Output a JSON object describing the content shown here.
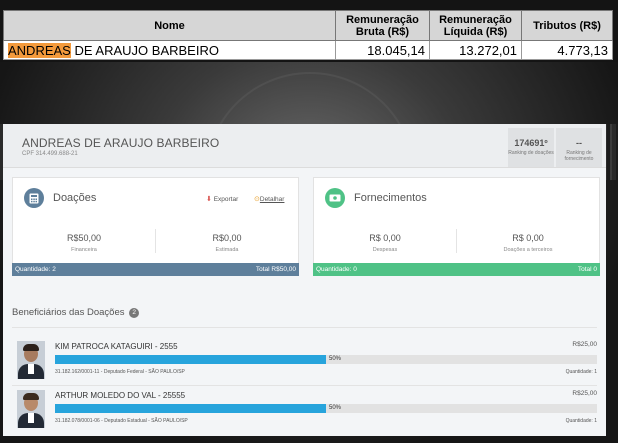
{
  "salary_table": {
    "headers": [
      "Nome",
      "Remuneração Bruta (R$)",
      "Remuneração Líquida (R$)",
      "Tributos (R$)"
    ],
    "row": {
      "name_highlight": "ANDREAS",
      "name_rest": " DE ARAUJO BARBEIRO",
      "bruta": "18.045,14",
      "liquida": "13.272,01",
      "tributos": "4.773,13"
    }
  },
  "profile": {
    "name": "ANDREAS DE ARAUJO BARBEIRO",
    "cpf": "CPF 314.499.688-21",
    "ranks": [
      {
        "value": "174691º",
        "label": "Ranking de doações"
      },
      {
        "value": "--",
        "label": "Ranking de fornecimento"
      }
    ]
  },
  "doacoes": {
    "title": "Doações",
    "export_label": "Exportar",
    "detail_label": "Detalhar",
    "metrics": [
      {
        "value": "R$50,00",
        "label": "Financeira"
      },
      {
        "value": "R$0,00",
        "label": "Estimada"
      }
    ],
    "footer_left": "Quantidade: 2",
    "footer_right": "Total R$50,00",
    "color": "#5e7f9b",
    "icon": "calculator-icon"
  },
  "fornecimentos": {
    "title": "Fornecimentos",
    "metrics": [
      {
        "value": "R$ 0,00",
        "label": "Despesas"
      },
      {
        "value": "R$ 0,00",
        "label": "Doações a terceiros"
      }
    ],
    "footer_left": "Quantidade: 0",
    "footer_right": "Total 0",
    "color": "#4fc286",
    "icon": "money-icon"
  },
  "beneficiarios": {
    "title": "Beneficiários das Doações",
    "count": "2",
    "items": [
      {
        "name": "KIM PATROCA KATAGUIRI - 2555",
        "amount": "R$25,00",
        "percent": 50,
        "percent_label": "50%",
        "info": "31.182.162/0001-11 - Deputado Federal - SÃO PAULO/SP",
        "qty": "Quantidade: 1"
      },
      {
        "name": "ARTHUR MOLEDO DO VAL - 25555",
        "amount": "R$25,00",
        "percent": 50,
        "percent_label": "50%",
        "info": "31.182.078/0001-06 - Deputado Estadual - SÃO PAULO/SP",
        "qty": "Quantidade: 1"
      }
    ]
  }
}
